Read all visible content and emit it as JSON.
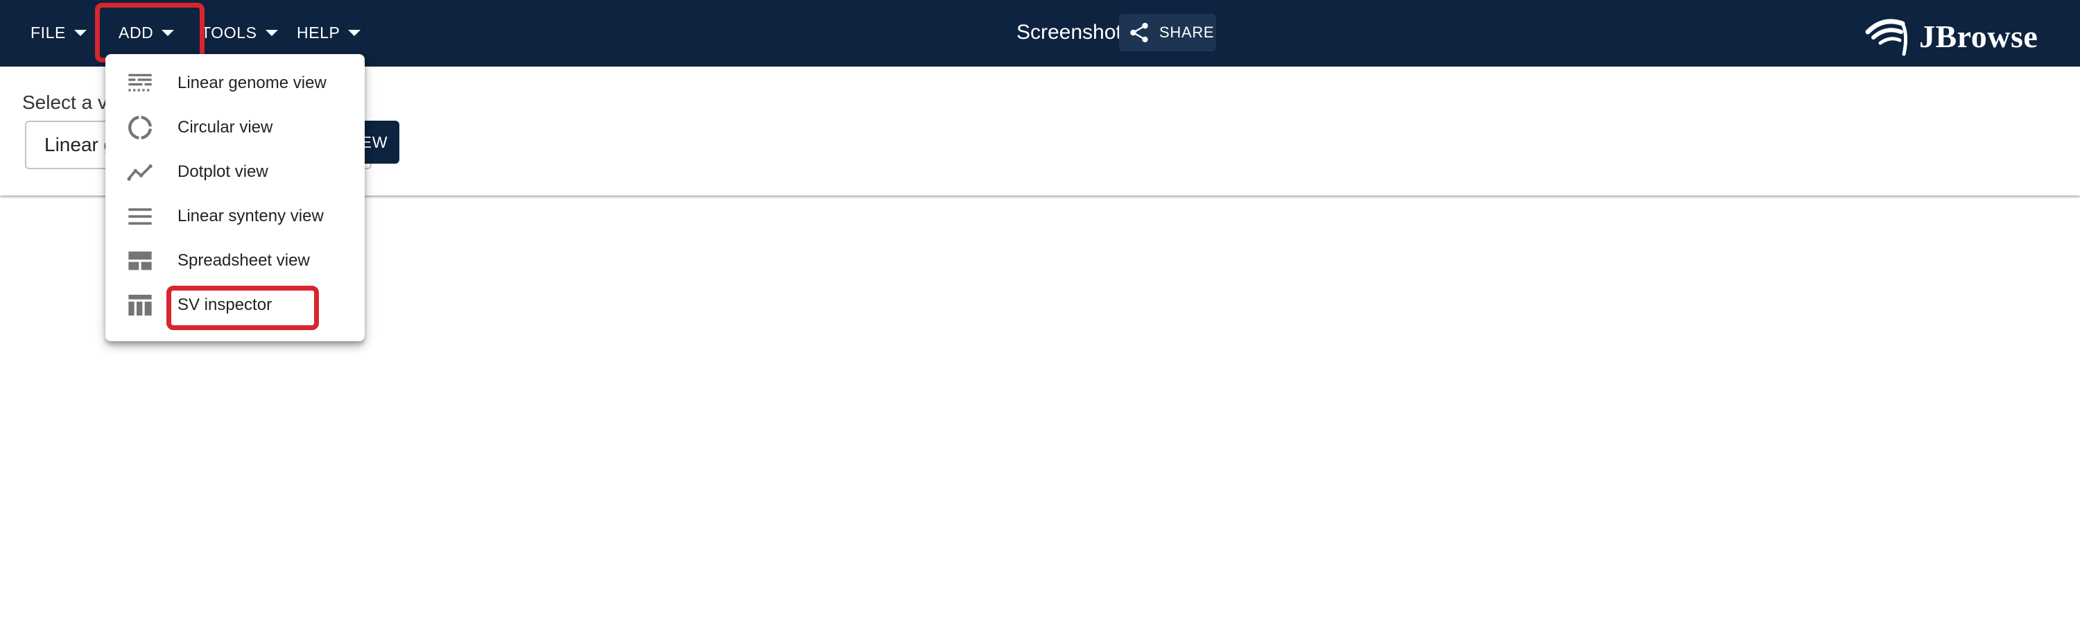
{
  "menubar": {
    "file_label": "FILE",
    "add_label": "ADD",
    "tools_label": "TOOLS",
    "help_label": "HELP"
  },
  "header": {
    "session_title": "Screenshot",
    "share_label": "SHARE",
    "logo_text": "JBrowse"
  },
  "view_selector": {
    "prompt": "Select a v",
    "selected_view": "Linear g",
    "launch_label": "EW"
  },
  "add_menu": {
    "items": [
      {
        "label": "Linear genome view",
        "icon": "linear-genome-view-icon"
      },
      {
        "label": "Circular view",
        "icon": "circular-view-icon"
      },
      {
        "label": "Dotplot view",
        "icon": "dotplot-view-icon"
      },
      {
        "label": "Linear synteny view",
        "icon": "linear-synteny-view-icon"
      },
      {
        "label": "Spreadsheet view",
        "icon": "spreadsheet-view-icon"
      },
      {
        "label": "SV inspector",
        "icon": "sv-inspector-icon"
      }
    ]
  },
  "colors": {
    "appbar": "#0d233f",
    "highlight": "#d7262f",
    "icon_gray": "#757575"
  }
}
